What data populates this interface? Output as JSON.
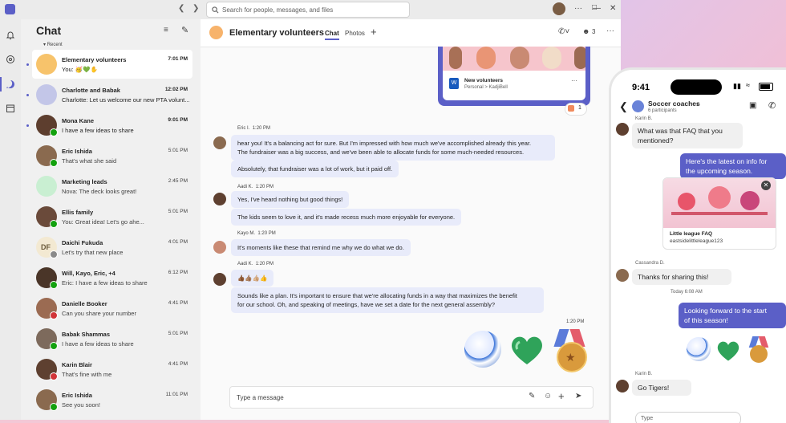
{
  "titlebar": {
    "search_placeholder": "Search for people, messages, and files"
  },
  "chat_list": {
    "title": "Chat",
    "section": "Recent",
    "items": [
      {
        "name": "Elementary volunteers",
        "preview": "You: 🥳💚✋",
        "time": "7:01 PM",
        "bold": true,
        "color": "#f7c36b"
      },
      {
        "name": "Charlotte and Babak",
        "preview": "Charlotte: Let us welcome our new PTA volunt...",
        "time": "12:02 PM",
        "bold": true,
        "color": "#c3c6e8"
      },
      {
        "name": "Mona Kane",
        "preview": "I have a few ideas to share",
        "time": "9:01 PM",
        "bold": true,
        "color": "#5d3e2e"
      },
      {
        "name": "Eric Ishida",
        "preview": "That's what she said",
        "time": "5:01 PM",
        "bold": false,
        "color": "#8a6a4f"
      },
      {
        "name": "Marketing leads",
        "preview": "Nova: The deck looks great!",
        "time": "2:45 PM",
        "bold": false,
        "color": "#c9efd2"
      },
      {
        "name": "Ellis family",
        "preview": "You: Great idea! Let's go ahe...",
        "time": "5:01 PM",
        "bold": false,
        "color": "#6a4a3a"
      },
      {
        "name": "Daichi Fukuda",
        "preview": "Let's try that new place",
        "time": "4:01 PM",
        "bold": false,
        "color": "#f3e9d2",
        "initials": "DF"
      },
      {
        "name": "Will, Kayo, Eric, +4",
        "preview": "Eric: I have a few ideas to share",
        "time": "6:12 PM",
        "bold": false,
        "color": "#4a3528"
      },
      {
        "name": "Danielle Booker",
        "preview": "Can you share your number",
        "time": "4:41 PM",
        "bold": false,
        "color": "#9b6b52"
      },
      {
        "name": "Babak Shammas",
        "preview": "I have a few ideas to share",
        "time": "5:01 PM",
        "bold": false,
        "color": "#7d6a5c"
      },
      {
        "name": "Karin Blair",
        "preview": "That's fine with me",
        "time": "4:41 PM",
        "bold": false,
        "color": "#5e4030"
      },
      {
        "name": "Eric Ishida",
        "preview": "See you soon!",
        "time": "11:01 PM",
        "bold": false,
        "color": "#8a6a4f"
      }
    ]
  },
  "conversation": {
    "title": "Elementary volunteers",
    "tabs": [
      "Chat",
      "Photos"
    ],
    "participant_count": "3",
    "file_card": {
      "name": "New volunteers",
      "path": "Personal > KadjiBell"
    },
    "reaction_count": "1",
    "messages": [
      {
        "author": "Eric I.",
        "time": "1:20 PM",
        "lines": [
          "hear you! It's a balancing act for sure. But I'm impressed with how much we've accomplished already this year.",
          "The fundraiser was a big success, and we've been able to allocate funds for some much-needed resources."
        ]
      },
      {
        "lines": [
          "Absolutely, that fundraiser was a lot of work, but it paid off."
        ]
      },
      {
        "author": "Aadi K.",
        "time": "1:20 PM",
        "lines": [
          "Yes, I've heard nothing but good things!"
        ]
      },
      {
        "lines": [
          "The kids seem to love it, and it's made recess much more enjoyable for everyone."
        ]
      },
      {
        "author": "Kayo M.",
        "time": "1:20 PM",
        "lines": [
          "It's moments like these that remind me why we do what we do."
        ]
      },
      {
        "author": "Aadi K.",
        "time": "1:20 PM",
        "lines": [
          "👍🏾👍🏽👍🏼👍"
        ]
      },
      {
        "lines": [
          "Sounds like a plan. It's important to ensure that we're allocating funds in a way that maximizes the benefit",
          "for our school. Oh, and speaking of meetings, have we set a date for the next general assembly?"
        ]
      }
    ],
    "own_time": "1:20 PM",
    "composer_placeholder": "Type a message"
  },
  "phone": {
    "clock": "9:41",
    "chat_title": "Soccer coaches",
    "participants": "6 participants",
    "messages": [
      {
        "author": "Karin B.",
        "text": [
          "What was that FAQ that you",
          "mentioned?"
        ],
        "dir": "in"
      },
      {
        "text": [
          "Here's the latest on info for",
          "the upcoming season."
        ],
        "dir": "out"
      },
      {
        "card_title": "Little league FAQ",
        "card_url": "eastsidelittleleague123"
      },
      {
        "author": "Cassandra D.",
        "text": [
          "Thanks for sharing this!"
        ],
        "dir": "in"
      },
      {
        "time": "Today 6:08 AM"
      },
      {
        "text": [
          "Looking forward to the start",
          "of this season!"
        ],
        "dir": "out"
      },
      {
        "author": "Karin B.",
        "text": [
          "Go Tigers!"
        ],
        "dir": "in"
      }
    ],
    "composer_placeholder": "Type"
  },
  "colors": {
    "accent": "#5b5fc7",
    "bubble": "#e8ebfa",
    "available": "#13a10e",
    "busy": "#d13438"
  }
}
